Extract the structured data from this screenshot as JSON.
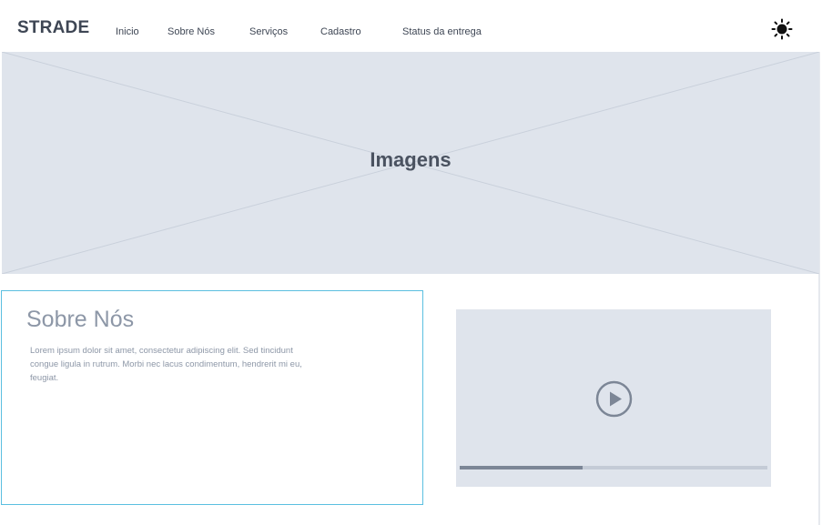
{
  "header": {
    "brand": "STRADE",
    "nav": [
      {
        "label": "Inicio"
      },
      {
        "label": "Sobre Nós"
      },
      {
        "label": "Serviços"
      },
      {
        "label": "Cadastro"
      },
      {
        "label": "Status da entrega"
      }
    ],
    "theme_icon": "sun-icon"
  },
  "hero": {
    "label": "Imagens"
  },
  "about": {
    "title": "Sobre Nós",
    "text": "Lorem ipsum dolor sit amet, consectetur adipiscing elit. Sed tincidunt congue ligula in rutrum. Morbi nec lacus condimentum, hendrerit mi eu, feugiat."
  },
  "video": {
    "play_icon": "play-circle-icon",
    "progress": 0.4
  },
  "colors": {
    "text": "#3e4654",
    "muted": "#8d97a7",
    "placeholder_bg": "#dfe4ec",
    "accent_border": "#5bbfe0"
  }
}
